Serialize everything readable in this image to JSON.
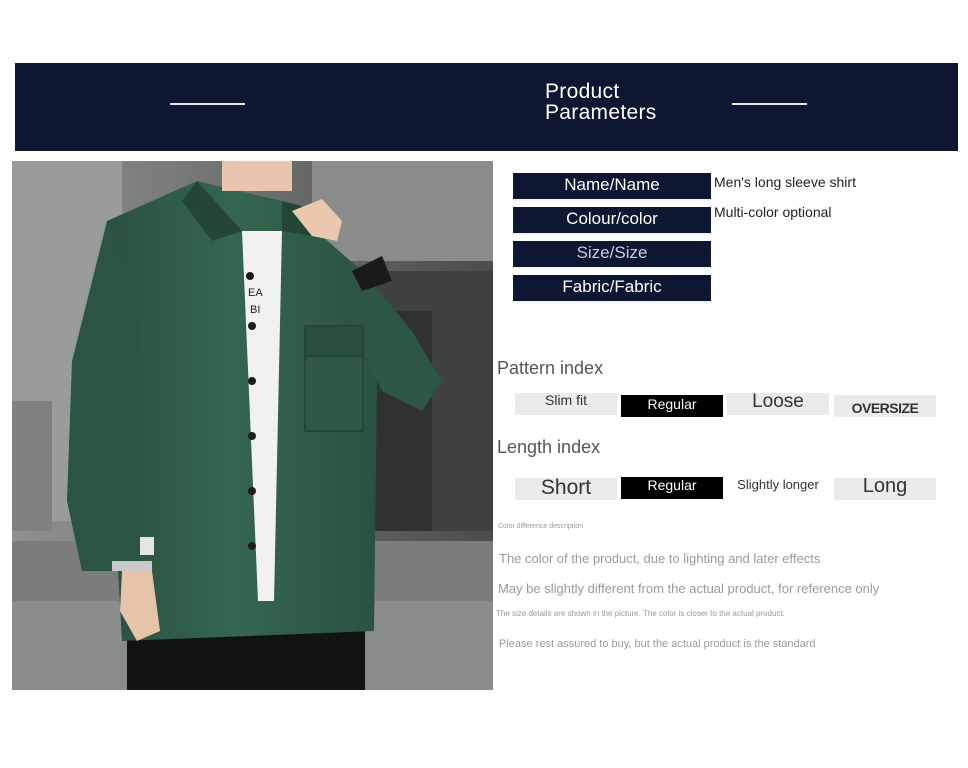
{
  "header": {
    "title": "Product\nParameters"
  },
  "photo": {
    "shirt_text": "EA\nBI"
  },
  "parameters": [
    {
      "label": "Name/Name",
      "value": "Men's long sleeve shirt"
    },
    {
      "label": "Colour/color",
      "value": "Multi-color optional"
    },
    {
      "label": "Size/Size",
      "value": ""
    },
    {
      "label": "Fabric/Fabric",
      "value": ""
    }
  ],
  "pattern_index": {
    "title": "Pattern index",
    "options": [
      "Slim fit",
      "Regular",
      "Loose",
      "OVERSIZE"
    ],
    "selected": "Regular"
  },
  "length_index": {
    "title": "Length index",
    "options": [
      "Short",
      "Regular",
      "Slightly longer",
      "Long"
    ],
    "selected": "Regular"
  },
  "notes": {
    "heading": "Color difference description",
    "line1": "The color of the product, due to lighting and later effects",
    "line2": "May be slightly different from the actual product, for reference only",
    "line3": "The size details are shown in the picture. The color is closer to the actual product.",
    "line4": "Please rest assured to buy, but the actual product is the standard"
  },
  "colors": {
    "banner": "#0d1731",
    "selected_option": "#000000",
    "option_bg": "#ebebeb",
    "shirt": "#2f5a46"
  }
}
